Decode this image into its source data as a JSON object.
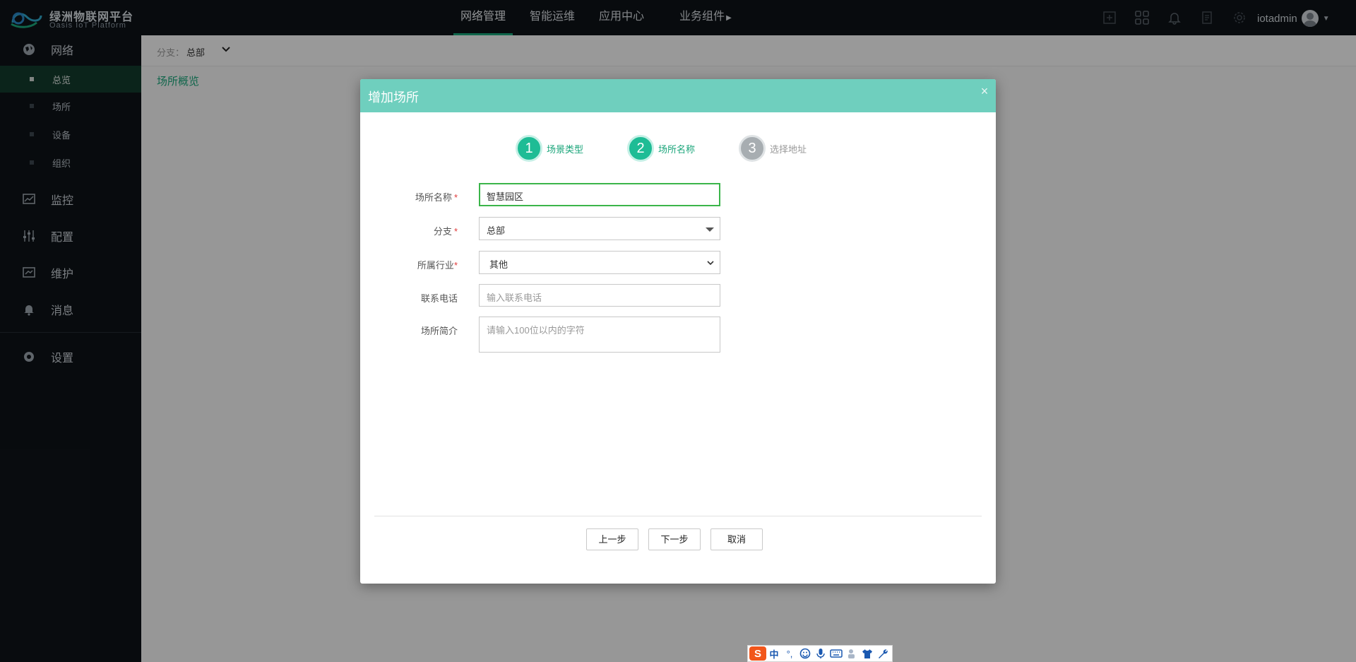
{
  "app": {
    "name": "绿洲物联网平台",
    "subtitle": "Oasis IoT Platform"
  },
  "topnav": {
    "items": [
      {
        "label": "网络管理"
      },
      {
        "label": "智能运维"
      },
      {
        "label": "应用中心"
      },
      {
        "label": "业务组件"
      }
    ]
  },
  "user": {
    "name": "iotadmin"
  },
  "sidebar": {
    "groups": [
      {
        "label": "网络",
        "icon": "network-icon"
      },
      {
        "label": "监控",
        "icon": "monitor-icon"
      },
      {
        "label": "配置",
        "icon": "sliders-icon"
      },
      {
        "label": "维护",
        "icon": "maintenance-icon"
      },
      {
        "label": "消息",
        "icon": "bell-icon"
      },
      {
        "label": "设置",
        "icon": "gear-icon"
      }
    ],
    "sub_items": [
      {
        "label": "总览"
      },
      {
        "label": "场所"
      },
      {
        "label": "设备"
      },
      {
        "label": "组织"
      }
    ]
  },
  "breadcrumb": {
    "label": "分支：",
    "value": "总部"
  },
  "page": {
    "overview_link": "场所概览"
  },
  "modal": {
    "title": "增加场所",
    "close": "×",
    "steps": [
      {
        "num": "1",
        "label": "场景类型"
      },
      {
        "num": "2",
        "label": "场所名称"
      },
      {
        "num": "3",
        "label": "选择地址"
      }
    ],
    "form": {
      "name_label": "场所名称",
      "name_value": "智慧园区",
      "branch_label": "分支",
      "branch_value": "总部",
      "industry_label": "所属行业",
      "industry_value": "其他",
      "phone_label": "联系电话",
      "phone_placeholder": "输入联系电话",
      "intro_label": "场所简介",
      "intro_placeholder": "请输入100位以内的字符",
      "required_mark": "*"
    },
    "buttons": {
      "prev": "上一步",
      "next": "下一步",
      "cancel": "取消"
    }
  },
  "ime": {
    "logo": "S",
    "mode": "中",
    "punct": "°,"
  },
  "colors": {
    "accent": "#1aa57a",
    "modal_header": "#6fcfbe",
    "sidebar_bg": "#0e1318",
    "step_active": "#1ebc95",
    "step_inactive": "#a7adb1"
  }
}
